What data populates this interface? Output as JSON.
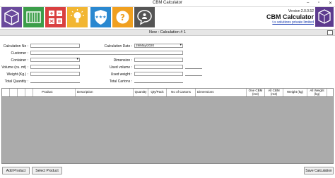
{
  "window": {
    "title": "CBM Calculator",
    "minimize": "–",
    "restore": "▫",
    "close": "✕"
  },
  "toolbar": {
    "buttons": [
      {
        "name": "box",
        "color": "#6a4a9c"
      },
      {
        "name": "container",
        "color": "#3c9e4a"
      },
      {
        "name": "calculator",
        "color": "#d94040"
      },
      {
        "name": "lightbulb",
        "color": "#f2b632"
      },
      {
        "name": "shield-stars",
        "color": "#2a88d0"
      },
      {
        "name": "help",
        "color": "#f0a020"
      },
      {
        "name": "chat",
        "color": "#555555"
      }
    ]
  },
  "brand": {
    "version": "Version 2.0.0.52",
    "name": "CBM Calculator",
    "company": "t.s solutions private limited",
    "logo_color": "#5d3a8e"
  },
  "form": {
    "title": "New : Calculation # 1",
    "calculation_no": {
      "label": "Calculation No :",
      "value": ""
    },
    "calculation_date": {
      "label": "Calculation Date :",
      "value": "29/May/2020"
    },
    "customer": {
      "label": "Customer :",
      "value": ""
    },
    "container": {
      "label": "Container :",
      "value": ""
    },
    "dimension": {
      "label": "Dimension :",
      "value": ""
    },
    "volume": {
      "label": "Volume (cu. mt) :",
      "value": ""
    },
    "used_volume": {
      "label": "Used volume :",
      "value": ""
    },
    "weight": {
      "label": "Weight (Kg.) :",
      "value": ""
    },
    "used_weight": {
      "label": "Used weight :",
      "value": ""
    },
    "total_quantity": {
      "label": "Total Quantity :",
      "value": ""
    },
    "total_cartons": {
      "label": "Total Cartons :",
      "value": ""
    }
  },
  "grid": {
    "columns": [
      "Product",
      "Description",
      "Quantity",
      "Qty/Pack",
      "No of Cartons",
      "Dimensions",
      "One CBM (m3)",
      "All CBM (m3)",
      "Weight (kg)",
      "All Weight (kg)"
    ]
  },
  "buttons": {
    "add_product": "Add Product",
    "select_product": "Select Product",
    "save": "Save Calculation"
  }
}
